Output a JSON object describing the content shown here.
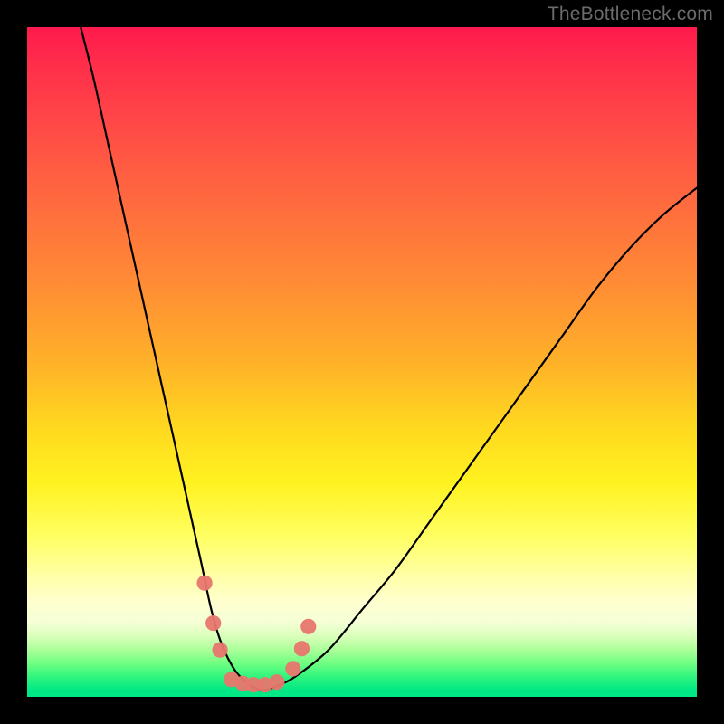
{
  "attribution": "TheBottleneck.com",
  "colors": {
    "border": "#000000",
    "curve": "#000000",
    "markers": "#e8776e",
    "gradient_top": "#ff1a4d",
    "gradient_mid": "#ffd91f",
    "gradient_bottom": "#00e885"
  },
  "chart_data": {
    "type": "line",
    "title": "",
    "xlabel": "",
    "ylabel": "",
    "xlim": [
      0,
      100
    ],
    "ylim": [
      0,
      100
    ],
    "grid": false,
    "legend": false,
    "notes": "Bottleneck-style V curve on rainbow gradient background. No axis ticks or numeric labels are rendered. x and y are normalized 0–100 (y=0 at bottom, y=100 at top). Values are approximate readings from pixel positions.",
    "series": [
      {
        "name": "curve",
        "x": [
          8,
          10,
          12,
          14,
          16,
          18,
          20,
          22,
          24,
          26,
          27.5,
          29,
          31,
          33,
          35,
          37,
          40,
          45,
          50,
          55,
          60,
          65,
          70,
          75,
          80,
          85,
          90,
          95,
          100
        ],
        "y": [
          100,
          92,
          83,
          74,
          65,
          56,
          47,
          38,
          29,
          20,
          13,
          8,
          4,
          2,
          1,
          1.5,
          3,
          7,
          13,
          19,
          26,
          33,
          40,
          47,
          54,
          61,
          67,
          72,
          76
        ]
      }
    ],
    "markers": [
      {
        "x": 26.5,
        "y": 17,
        "r": 1.1
      },
      {
        "x": 27.8,
        "y": 11,
        "r": 1.1
      },
      {
        "x": 28.8,
        "y": 7,
        "r": 1.1
      },
      {
        "x": 30.5,
        "y": 2.6,
        "r": 1.1
      },
      {
        "x": 32.2,
        "y": 2.0,
        "r": 1.1
      },
      {
        "x": 33.8,
        "y": 1.8,
        "r": 1.1
      },
      {
        "x": 35.5,
        "y": 1.8,
        "r": 1.1
      },
      {
        "x": 37.3,
        "y": 2.2,
        "r": 1.1
      },
      {
        "x": 39.7,
        "y": 4.2,
        "r": 1.1
      },
      {
        "x": 41.0,
        "y": 7.2,
        "r": 1.1
      },
      {
        "x": 42.0,
        "y": 10.5,
        "r": 1.1
      }
    ]
  }
}
